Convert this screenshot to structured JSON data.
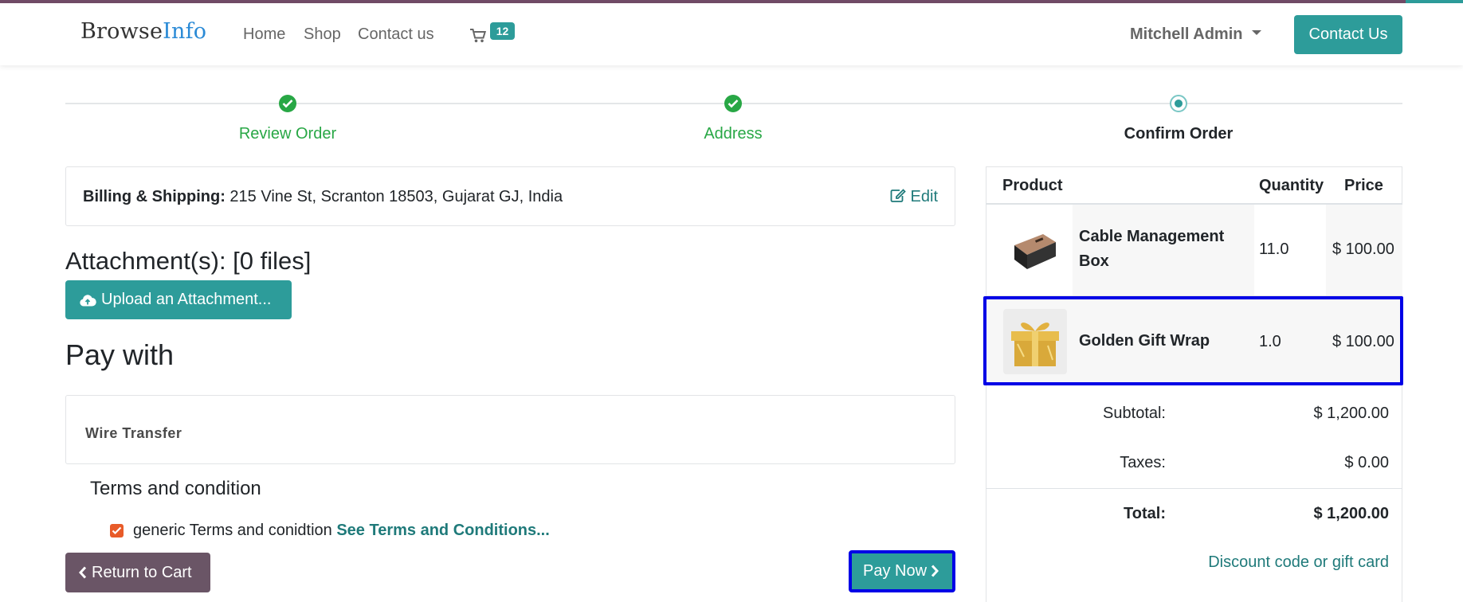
{
  "brand": {
    "part1": "Browse",
    "part2": "Info"
  },
  "nav": {
    "items": [
      {
        "label": "Home"
      },
      {
        "label": "Shop"
      },
      {
        "label": "Contact us"
      }
    ],
    "cart_count": "12",
    "user_name": "Mitchell Admin",
    "contact_button": "Contact Us"
  },
  "steps": [
    {
      "label": "Review Order",
      "status": "done"
    },
    {
      "label": "Address",
      "status": "done"
    },
    {
      "label": "Confirm Order",
      "status": "current"
    }
  ],
  "billing": {
    "label": "Billing & Shipping:",
    "address": " 215 Vine St, Scranton 18503, Gujarat GJ, India",
    "edit_label": "Edit"
  },
  "attachments": {
    "title": "Attachment(s): [0 files]",
    "upload_button": "Upload an Attachment..."
  },
  "payment": {
    "title": "Pay with",
    "method": "Wire Transfer"
  },
  "terms": {
    "title": "Terms and condition",
    "text": "generic Terms and conidtion ",
    "link": "See Terms and Conditions..."
  },
  "actions": {
    "return_label": "Return to Cart",
    "pay_label": "Pay Now"
  },
  "summary": {
    "headers": {
      "product": "Product",
      "quantity": "Quantity",
      "price": "Price"
    },
    "items": [
      {
        "name_line1": "Cable Management",
        "name_line2": "Box",
        "quantity": "11.0",
        "price": "$ 100.00"
      },
      {
        "name": "Golden Gift Wrap",
        "quantity": "1.0",
        "price": "$ 100.00"
      }
    ],
    "subtotal_label": "Subtotal:",
    "subtotal": "$ 1,200.00",
    "taxes_label": "Taxes:",
    "taxes": "$ 0.00",
    "total_label": "Total:",
    "total": "$ 1,200.00",
    "discount_link": "Discount code or gift card"
  },
  "colors": {
    "primary": "#2d9c9a",
    "success": "#28a745",
    "secondary": "#6a5566",
    "highlight": "#0000e6"
  }
}
